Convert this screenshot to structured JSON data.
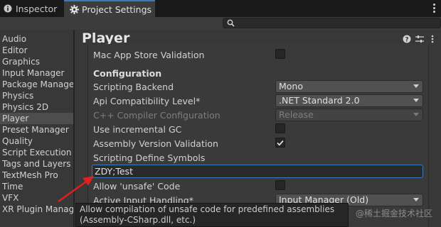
{
  "tabs": {
    "inspector": "Inspector",
    "project": "Project Settings"
  },
  "sidebar": {
    "items": [
      {
        "label": "Audio"
      },
      {
        "label": "Editor"
      },
      {
        "label": "Graphics"
      },
      {
        "label": "Input Manager"
      },
      {
        "label": "Package Manager"
      },
      {
        "label": "Physics"
      },
      {
        "label": "Physics 2D"
      },
      {
        "label": "Player",
        "active": true
      },
      {
        "label": "Preset Manager"
      },
      {
        "label": "Quality"
      },
      {
        "label": "Script Execution Order"
      },
      {
        "label": "Tags and Layers"
      },
      {
        "label": "TextMesh Pro"
      },
      {
        "label": "Time"
      },
      {
        "label": "VFX"
      },
      {
        "label": "XR Plugin Management"
      }
    ]
  },
  "main": {
    "title": "Player",
    "rows": {
      "mac_app_store": "Mac App Store Validation",
      "configuration": "Configuration",
      "scripting_backend": "Scripting Backend",
      "api_level": "Api Compatibility Level*",
      "cpp_config": "C++ Compiler Configuration",
      "incremental_gc": "Use incremental GC",
      "assembly_validation": "Assembly Version Validation",
      "define_symbols": "Scripting Define Symbols",
      "allow_unsafe": "Allow 'unsafe' Code",
      "active_input": "Active Input Handling*"
    },
    "values": {
      "scripting_backend": "Mono",
      "api_level": ".NET Standard 2.0",
      "cpp_config": "Release",
      "define_symbols": "ZDY;Test",
      "active_input": "Input Manager (Old)"
    },
    "checks": {
      "mac_app_store": false,
      "incremental_gc": false,
      "assembly_validation": true,
      "allow_unsafe": false
    }
  },
  "tooltip": "Allow compilation of unsafe code for predefined assemblies (Assembly-CSharp.dll, etc.)",
  "watermark": "@稀土掘金技术社区",
  "colors": {
    "accent": "#3a79bb",
    "annotation_arrow": "#e02020"
  }
}
